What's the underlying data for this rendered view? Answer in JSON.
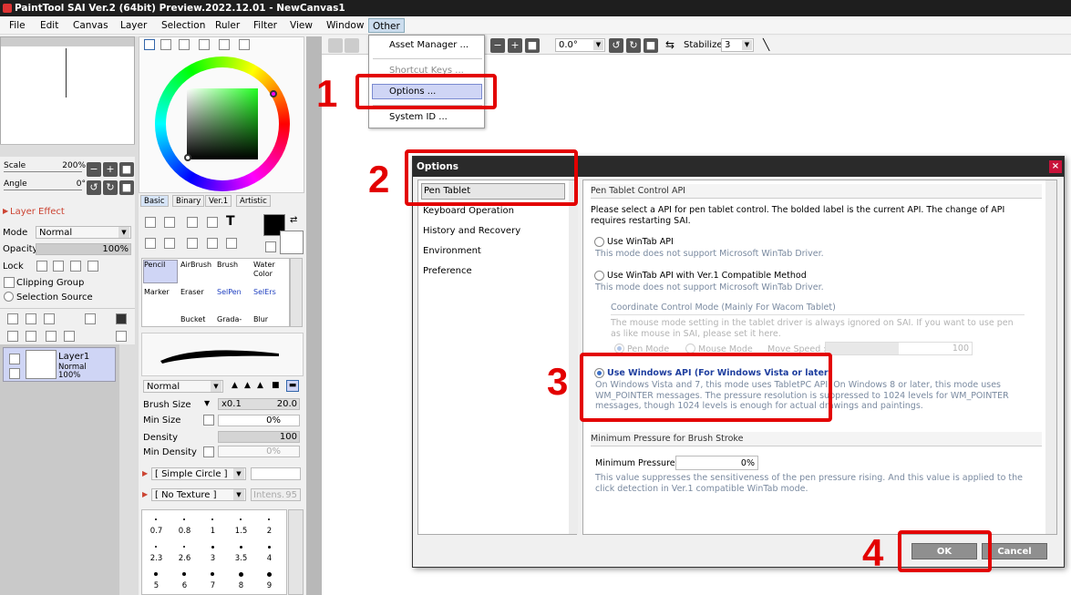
{
  "app": {
    "title": "PaintTool SAI Ver.2 (64bit) Preview.2022.12.01 - NewCanvas1"
  },
  "menu": [
    "File",
    "Edit",
    "Canvas",
    "Layer",
    "Selection",
    "Ruler",
    "Filter",
    "View",
    "Window",
    "Other"
  ],
  "other_menu": {
    "items": [
      "Asset Manager ...",
      "Shortcut Keys ...",
      "Options ...",
      "System ID ..."
    ]
  },
  "toolbar": {
    "rotation": "0.0°",
    "stabilizer_label": "Stabilizer",
    "stabilizer_value": "3"
  },
  "navigator": {
    "scale_label": "Scale",
    "scale_value": "200%",
    "angle_label": "Angle",
    "angle_value": "0°"
  },
  "layer_panel": {
    "header": "Layer Effect",
    "mode_label": "Mode",
    "mode_value": "Normal",
    "opacity_label": "Opacity",
    "opacity_value": "100%",
    "lock_label": "Lock",
    "clipping_group": "Clipping Group",
    "selection_source": "Selection Source",
    "layer": {
      "name": "Layer1",
      "mode": "Normal",
      "opacity": "100%"
    }
  },
  "color_tabs": [
    "Basic",
    "Binary",
    "Ver.1",
    "Artistic"
  ],
  "tools": [
    "Pencil",
    "AirBrush",
    "Brush",
    "Water Color",
    "Marker",
    "Eraser",
    "SelPen",
    "SelErs",
    "Bucket",
    "Grada-",
    "Blur"
  ],
  "brush": {
    "blend_mode": "Normal",
    "size_label": "Brush Size",
    "size_mult": "x0.1",
    "size_value": "20.0",
    "min_size_label": "Min Size",
    "min_size_value": "0%",
    "density_label": "Density",
    "density_value": "100",
    "min_density_label": "Min Density",
    "min_density_value": "0%",
    "shape": "[ Simple Circle ]",
    "texture": "[ No Texture ]",
    "intensity": "Intens.",
    "intensity_value": "95",
    "sizes": [
      "0.7",
      "0.8",
      "1",
      "1.5",
      "2",
      "2.3",
      "2.6",
      "3",
      "3.5",
      "4",
      "5",
      "6",
      "7",
      "8",
      "9"
    ]
  },
  "dialog": {
    "title": "Options",
    "categories": [
      "Pen Tablet",
      "Keyboard Operation",
      "History and Recovery",
      "Environment",
      "Preference"
    ],
    "section1": "Pen Tablet Control API",
    "intro": "Please select a API for pen tablet control. The bolded label is the current API. The change of API requires restarting SAI.",
    "opt1_label": "Use WinTab API",
    "opt1_hint": "This mode does not support Microsoft WinTab Driver.",
    "opt2_label": "Use WinTab API with Ver.1 Compatible Method",
    "opt2_hint": "This mode does not support Microsoft WinTab Driver.",
    "coord_head": "Coordinate Control Mode (Mainly For Wacom Tablet)",
    "coord_text": "The mouse mode setting in the tablet driver is always ignored on SAI. If you want to use pen as like mouse in SAI, please set it here.",
    "pen_mode": "Pen Mode",
    "mouse_mode": "Mouse Mode",
    "move_speed": "Move Speed :",
    "move_speed_value": "100",
    "opt3_label": "Use Windows API (For Windows Vista or later)",
    "opt3_hint": "On Windows Vista and 7, this mode uses TabletPC API. On Windows 8 or later, this mode uses WM_POINTER messages. The pressure resolution is suppressed to 1024 levels for WM_POINTER messages, though 1024 levels is enough for actual drawings and paintings.",
    "section2": "Minimum Pressure for Brush Stroke",
    "min_pressure_label": "Minimum Pressure :",
    "min_pressure_value": "0%",
    "min_pressure_hint": "This value suppresses the sensitiveness of the pen pressure rising. And this value is applied to the click detection in Ver.1 compatible WinTab mode.",
    "ok": "OK",
    "cancel": "Cancel"
  },
  "annotations": [
    "1",
    "2",
    "3",
    "4"
  ],
  "colors": {
    "annotation": "#e30000",
    "accent": "#3b6fc7"
  }
}
